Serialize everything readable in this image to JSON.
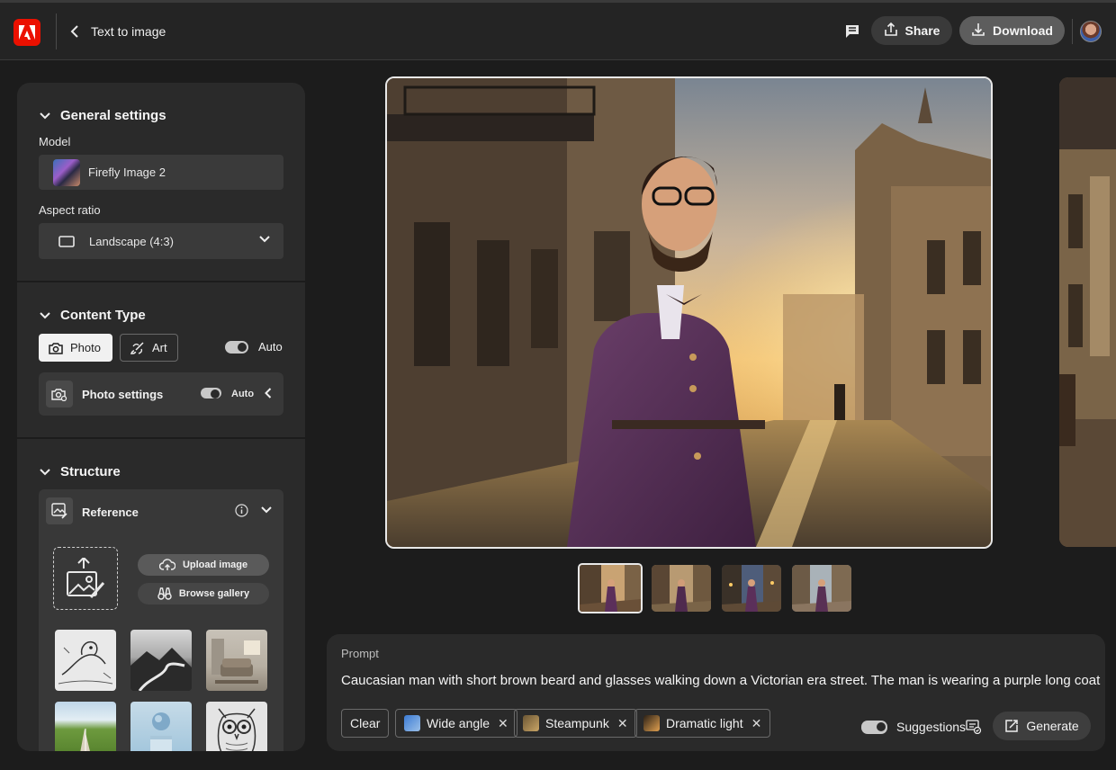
{
  "header": {
    "title": "Text to image",
    "share_label": "Share",
    "download_label": "Download",
    "brand_color": "#eb1000"
  },
  "general_settings": {
    "title": "General settings",
    "model_label": "Model",
    "model_value": "Firefly Image 2",
    "aspect_label": "Aspect ratio",
    "aspect_value": "Landscape (4:3)"
  },
  "content_type": {
    "title": "Content Type",
    "photo_label": "Photo",
    "art_label": "Art",
    "auto_label": "Auto",
    "photo_settings_label": "Photo settings",
    "photo_settings_auto": "Auto"
  },
  "structure": {
    "title": "Structure",
    "reference_label": "Reference",
    "upload_label": "Upload image",
    "browse_label": "Browse gallery",
    "reference_thumbs": [
      "bird-sketch",
      "mountain-landscape",
      "living-room",
      "field-road",
      "sphere-pedestal",
      "owl-sketch"
    ]
  },
  "prompt": {
    "label": "Prompt",
    "text": "Caucasian man with short brown beard and glasses walking down a Victorian era street. The man is wearing a purple long coat",
    "clear_label": "Clear",
    "chips": [
      "Wide angle",
      "Steampunk",
      "Dramatic light"
    ],
    "suggestions_label": "Suggestions",
    "generate_label": "Generate"
  },
  "icons": [
    "adobe-logo-icon",
    "back-chevron-icon",
    "comment-icon",
    "share-icon",
    "download-icon",
    "camera-icon",
    "brush-icon",
    "photo-settings-icon",
    "reference-icon",
    "info-icon",
    "cloud-upload-icon",
    "binoculars-icon",
    "generate-icon"
  ]
}
